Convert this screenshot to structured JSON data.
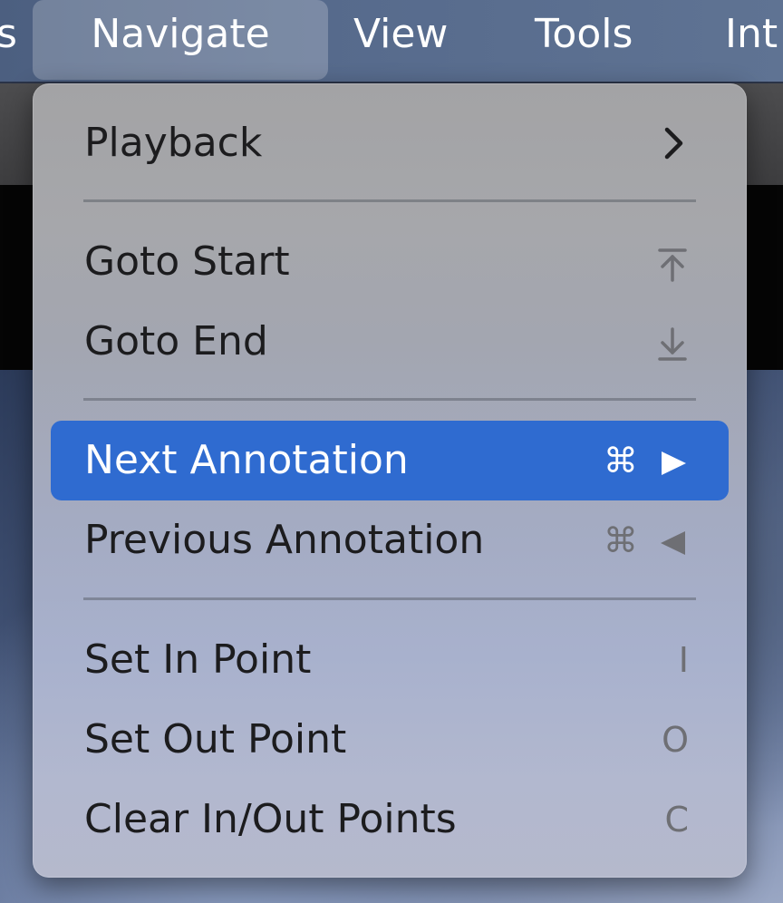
{
  "menubar": {
    "items": [
      {
        "label": "s"
      },
      {
        "label": "Navigate"
      },
      {
        "label": "View"
      },
      {
        "label": "Tools"
      },
      {
        "label": "Int"
      }
    ]
  },
  "menu": {
    "items": [
      {
        "label": "Playback",
        "shortcut": "",
        "submenu": true,
        "icon": "chevron-right-icon"
      },
      {
        "label": "Goto Start",
        "shortcut": "",
        "icon": "arrow-to-top-icon"
      },
      {
        "label": "Goto End",
        "shortcut": "",
        "icon": "arrow-to-bottom-icon"
      },
      {
        "label": "Next Annotation",
        "shortcut": "⌘",
        "icon": "play-right-icon",
        "highlighted": true
      },
      {
        "label": "Previous Annotation",
        "shortcut": "⌘",
        "icon": "play-left-icon"
      },
      {
        "label": "Set In Point",
        "shortcut": "I"
      },
      {
        "label": "Set Out Point",
        "shortcut": "O"
      },
      {
        "label": "Clear In/Out Points",
        "shortcut": "C"
      }
    ]
  },
  "colors": {
    "highlight": "#2f6bd0",
    "menu_text": "#1c1c1e",
    "shortcut_text": "#6e6f74"
  }
}
